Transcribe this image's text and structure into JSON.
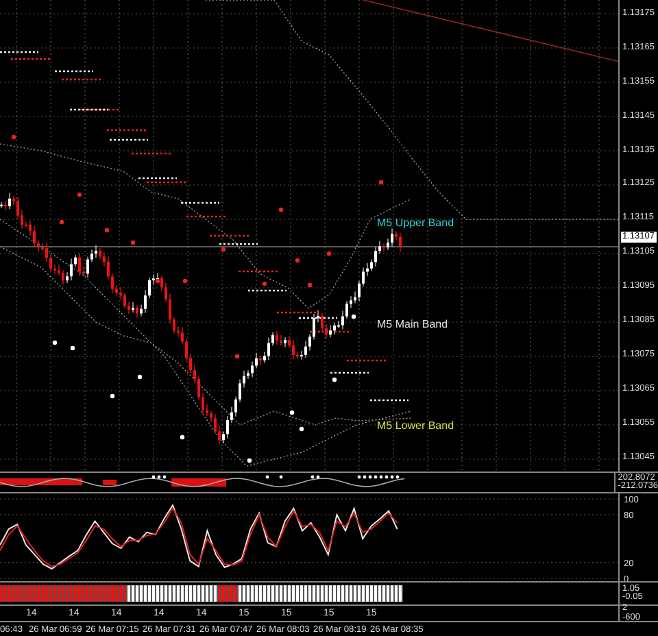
{
  "main_chart": {
    "price_axis": [
      "1.13175",
      "1.13165",
      "1.13155",
      "1.13145",
      "1.13135",
      "1.13125",
      "1.13115",
      "1.13105",
      "1.13095",
      "1.13085",
      "1.13075",
      "1.13065",
      "1.13055",
      "1.13045"
    ],
    "current_price": "1.13107",
    "band_labels": [
      {
        "text": "M5 Upper Band",
        "color": "#33cccc"
      },
      {
        "text": "M5 Main Band",
        "color": "#e0e0e0"
      },
      {
        "text": "M5 Lower Band",
        "color": "#dddd44"
      }
    ]
  },
  "oscillator_panel": {
    "axis": [
      "202.8072",
      "-212.0736"
    ]
  },
  "stochastic_panel": {
    "chart_data": {
      "type": "line",
      "ylim": [
        0,
        100
      ],
      "yticks": [
        0,
        20,
        80,
        100
      ],
      "series": [
        {
          "color": "#e8e8e8",
          "values": [
            42,
            62,
            68,
            42,
            30,
            18,
            12,
            20,
            28,
            35,
            55,
            72,
            58,
            44,
            38,
            52,
            46,
            58,
            55,
            75,
            92,
            62,
            22,
            15,
            60,
            30,
            14,
            18,
            25,
            62,
            82,
            45,
            40,
            72,
            88,
            60,
            70,
            52,
            30,
            80,
            60,
            88,
            50,
            66,
            75,
            85,
            62
          ]
        },
        {
          "color": "#dd2222",
          "values": [
            35,
            55,
            66,
            50,
            35,
            22,
            15,
            18,
            25,
            32,
            48,
            66,
            62,
            50,
            40,
            48,
            48,
            54,
            56,
            70,
            88,
            70,
            30,
            18,
            50,
            35,
            18,
            17,
            22,
            55,
            80,
            52,
            40,
            65,
            85,
            65,
            68,
            58,
            35,
            72,
            65,
            82,
            58,
            62,
            72,
            82,
            70
          ]
        }
      ]
    }
  },
  "signal_bar_panel": {
    "axis": [
      "1.05",
      "-0.05"
    ],
    "cells": [
      {
        "color": "#ee1111"
      },
      {
        "color": "#ee1111"
      },
      {
        "color": "#ee1111"
      },
      {
        "color": "#ee1111"
      },
      {
        "color": "#ee1111"
      },
      {
        "color": "#ee1111"
      },
      {
        "color": "#ee1111"
      },
      {
        "color": "#ee1111"
      },
      {
        "color": "#ee1111"
      },
      {
        "color": "#ee1111"
      },
      {
        "color": "#ee1111"
      },
      {
        "color": "#ee1111"
      },
      {
        "color": "#ee1111"
      },
      {
        "color": "#ee1111"
      },
      {
        "color": "#ee1111"
      },
      {
        "color": "#ee1111"
      },
      {
        "color": "#ee1111"
      },
      {
        "color": "#ee1111"
      },
      {
        "color": "#ee1111"
      },
      {
        "color": "#ee1111"
      },
      {
        "color": "#ee1111"
      },
      {
        "color": "#ee1111"
      },
      {
        "color": "#ee1111"
      },
      {
        "color": "#ee1111"
      },
      {
        "color": "#ee1111"
      },
      {
        "color": "#ee1111"
      },
      {
        "color": "#ee1111"
      },
      {
        "color": "#ee1111"
      },
      {
        "color": "#ee1111"
      },
      {
        "color": "#ee1111"
      },
      {
        "color": "#ee1111"
      },
      {
        "color": "#ffffff"
      },
      {
        "color": "#ffffff"
      },
      {
        "color": "#ffffff"
      },
      {
        "color": "#ffffff"
      },
      {
        "color": "#ffffff"
      },
      {
        "color": "#ffffff"
      },
      {
        "color": "#ffffff"
      },
      {
        "color": "#ffffff"
      },
      {
        "color": "#ffffff"
      },
      {
        "color": "#ffffff"
      },
      {
        "color": "#ffffff"
      },
      {
        "color": "#ffffff"
      },
      {
        "color": "#ffffff"
      },
      {
        "color": "#ffffff"
      },
      {
        "color": "#ffffff"
      },
      {
        "color": "#ffffff"
      },
      {
        "color": "#ffffff"
      },
      {
        "color": "#ffffff"
      },
      {
        "color": "#ffffff"
      },
      {
        "color": "#ffffff"
      },
      {
        "color": "#ffffff"
      },
      {
        "color": "#ffffff"
      },
      {
        "color": "#ee1111"
      },
      {
        "color": "#ee1111"
      },
      {
        "color": "#ee1111"
      },
      {
        "color": "#ee1111"
      },
      {
        "color": "#ee1111"
      },
      {
        "color": "#ffffff"
      },
      {
        "color": "#ffffff"
      },
      {
        "color": "#ffffff"
      },
      {
        "color": "#ffffff"
      },
      {
        "color": "#ffffff"
      },
      {
        "color": "#ffffff"
      },
      {
        "color": "#ffffff"
      },
      {
        "color": "#ffffff"
      },
      {
        "color": "#ffffff"
      },
      {
        "color": "#ffffff"
      },
      {
        "color": "#ffffff"
      },
      {
        "color": "#ffffff"
      },
      {
        "color": "#ffffff"
      },
      {
        "color": "#ffffff"
      },
      {
        "color": "#ffffff"
      },
      {
        "color": "#ffffff"
      },
      {
        "color": "#ffffff"
      },
      {
        "color": "#ffffff"
      },
      {
        "color": "#ffffff"
      },
      {
        "color": "#ffffff"
      },
      {
        "color": "#ffffff"
      },
      {
        "color": "#ffffff"
      },
      {
        "color": "#ffffff"
      },
      {
        "color": "#ffffff"
      },
      {
        "color": "#ffffff"
      },
      {
        "color": "#ffffff"
      },
      {
        "color": "#ffffff"
      },
      {
        "color": "#ffffff"
      },
      {
        "color": "#ffffff"
      },
      {
        "color": "#ffffff"
      },
      {
        "color": "#ffffff"
      },
      {
        "color": "#ffffff"
      },
      {
        "color": "#ffffff"
      },
      {
        "color": "#ffffff"
      },
      {
        "color": "#ffffff"
      },
      {
        "color": "#ffffff"
      },
      {
        "color": "#ffffff"
      },
      {
        "color": "#ffffff"
      },
      {
        "color": "#ffffff"
      },
      {
        "color": "#ffffff"
      }
    ]
  },
  "hour_panel": {
    "axis": [
      "2",
      "-600"
    ],
    "labels": [
      "14",
      "14",
      "14",
      "14",
      "14",
      "15",
      "15",
      "15",
      "15"
    ]
  },
  "time_axis": [
    "06:43",
    "26 Mar 06:59",
    "26 Mar 07:15",
    "26 Mar 07:31",
    "26 Mar 07:47",
    "26 Mar 08:03",
    "26 Mar 08:19",
    "26 Mar 08:35"
  ]
}
